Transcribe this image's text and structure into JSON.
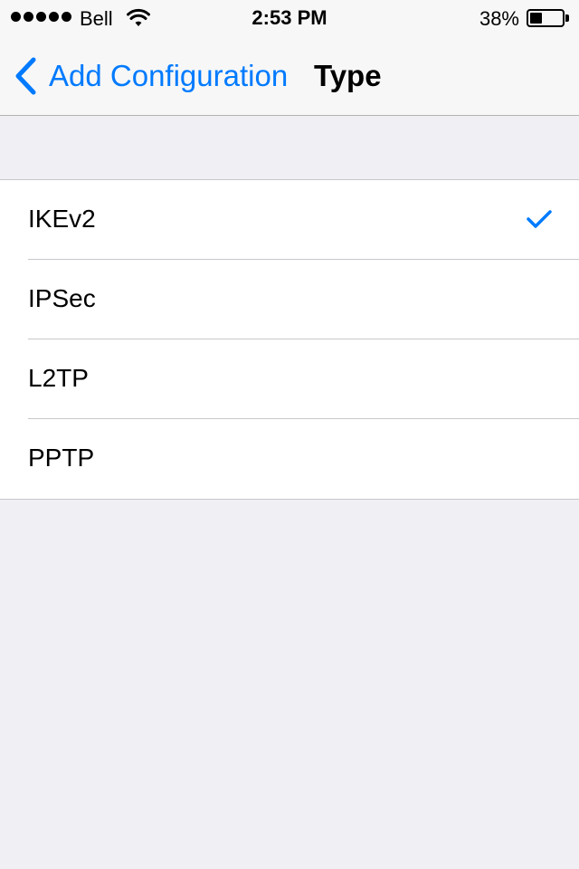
{
  "status_bar": {
    "carrier": "Bell",
    "time": "2:53 PM",
    "battery_percent": "38%",
    "battery_level": 0.38,
    "signal_bars": 5,
    "wifi_icon": "wifi-icon"
  },
  "nav": {
    "back_label": "Add Configuration",
    "back_icon": "chevron-left-icon",
    "title": "Type"
  },
  "options": [
    {
      "label": "IKEv2",
      "selected": true
    },
    {
      "label": "IPSec",
      "selected": false
    },
    {
      "label": "L2TP",
      "selected": false
    },
    {
      "label": "PPTP",
      "selected": false
    }
  ],
  "colors": {
    "accent": "#007aff",
    "background": "#efeff4",
    "separator": "#c8c7cc"
  }
}
